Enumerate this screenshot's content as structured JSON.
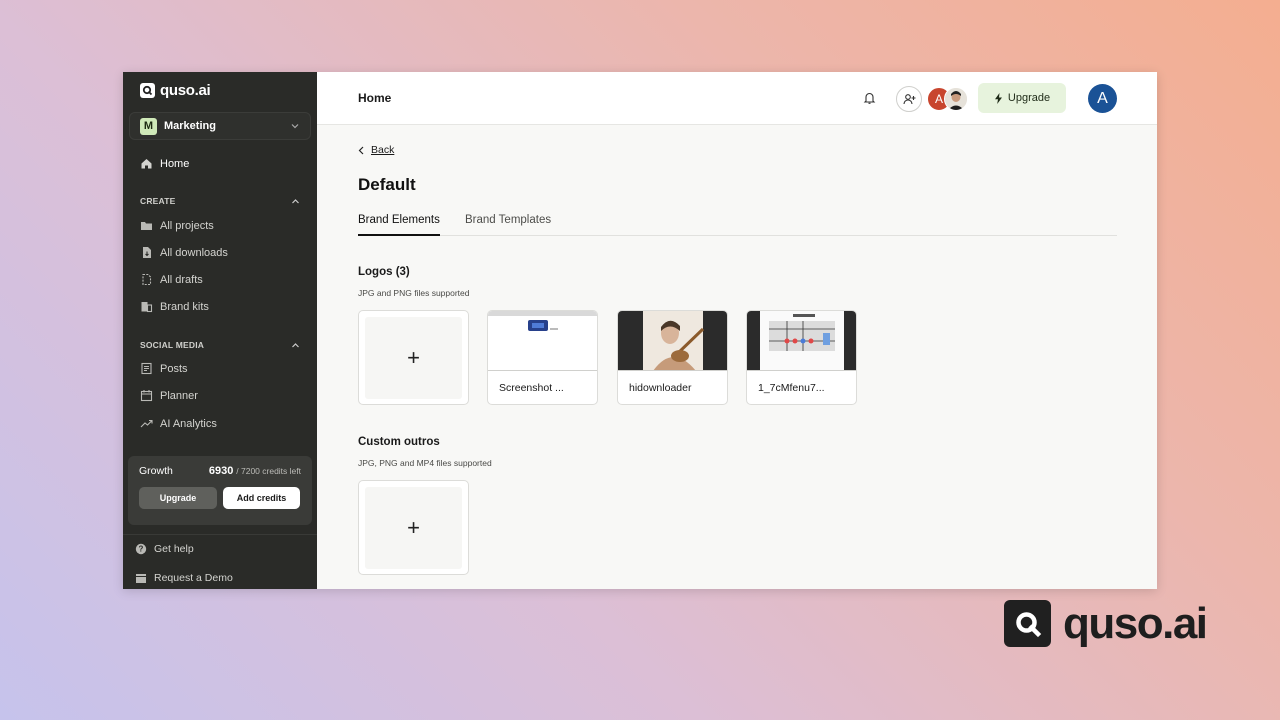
{
  "brand": {
    "logo_text": "quso.ai"
  },
  "workspace": {
    "badge": "M",
    "name": "Marketing"
  },
  "sidebar": {
    "home": "Home",
    "create_label": "CREATE",
    "create_items": [
      {
        "label": "All projects",
        "icon": "folder-icon"
      },
      {
        "label": "All downloads",
        "icon": "download-file-icon"
      },
      {
        "label": "All drafts",
        "icon": "draft-icon"
      },
      {
        "label": "Brand kits",
        "icon": "brand-kit-icon"
      }
    ],
    "social_label": "SOCIAL MEDIA",
    "social_items": [
      {
        "label": "Posts",
        "icon": "posts-icon"
      },
      {
        "label": "Planner",
        "icon": "calendar-icon"
      },
      {
        "label": "AI Analytics",
        "icon": "trend-icon"
      }
    ]
  },
  "credits": {
    "plan": "Growth",
    "used": "6930",
    "rest": "/ 7200 credits left",
    "upgrade_label": "Upgrade",
    "add_label": "Add credits"
  },
  "bottom": {
    "help": "Get help",
    "demo": "Request a Demo"
  },
  "topbar": {
    "title": "Home",
    "upgrade_label": "Upgrade",
    "avatar_letter": "A",
    "member_initial": "A"
  },
  "page": {
    "back_label": "Back",
    "title": "Default",
    "tabs": [
      "Brand Elements",
      "Brand Templates"
    ]
  },
  "logos": {
    "title": "Logos (3)",
    "subtitle": "JPG and PNG files supported",
    "items": [
      "Screenshot ...",
      "hidownloader",
      "1_7cMfenu7..."
    ]
  },
  "outros": {
    "title": "Custom outros",
    "subtitle": "JPG, PNG and MP4 files supported"
  },
  "colors": {
    "sidebar_bg": "#2a2b28",
    "upgrade_bg": "#e7f3dd",
    "avatar_blue": "#1a5296"
  }
}
